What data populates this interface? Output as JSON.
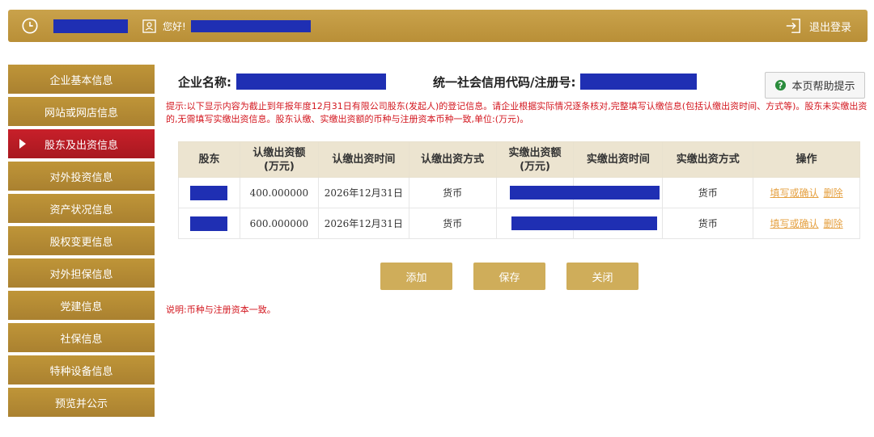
{
  "header": {
    "greeting": "您好!",
    "logout_label": "退出登录"
  },
  "sidebar": {
    "items": [
      {
        "label": "企业基本信息"
      },
      {
        "label": "网站或网店信息"
      },
      {
        "label": "股东及出资信息"
      },
      {
        "label": "对外投资信息"
      },
      {
        "label": "资产状况信息"
      },
      {
        "label": "股权变更信息"
      },
      {
        "label": "对外担保信息"
      },
      {
        "label": "党建信息"
      },
      {
        "label": "社保信息"
      },
      {
        "label": "特种设备信息"
      },
      {
        "label": "预览并公示"
      }
    ],
    "active_index": 2
  },
  "main": {
    "company_label": "企业名称:",
    "credit_label": "统一社会信用代码/注册号:",
    "help_label": "本页帮助提示",
    "tip": "提示:以下显示内容为截止到年报年度12月31日有限公司股东(发起人)的登记信息。请企业根据实际情况逐条核对,完整填写认缴信息(包括认缴出资时间、方式等)。股东未实缴出资的,无需填写实缴出资信息。股东认缴、实缴出资额的币种与注册资本币种一致,单位:(万元)。",
    "table": {
      "headers": [
        "股东",
        "认缴出资额\n(万元)",
        "认缴出资时间",
        "认缴出资方式",
        "实缴出资额\n(万元)",
        "实缴出资时间",
        "实缴出资方式",
        "操作"
      ],
      "rows": [
        {
          "subscribed_amount": "400.000000",
          "subscribed_date": "2026年12月31日",
          "subscribed_method": "货币",
          "paid_method": "货币",
          "action_edit": "填写或确认",
          "action_delete": "删除"
        },
        {
          "subscribed_amount": "600.000000",
          "subscribed_date": "2026年12月31日",
          "subscribed_method": "货币",
          "paid_method": "货币",
          "action_edit": "填写或确认",
          "action_delete": "删除"
        }
      ]
    },
    "buttons": {
      "add": "添加",
      "save": "保存",
      "close": "关闭"
    },
    "note": "说明:币种与注册资本一致。"
  },
  "colors": {
    "gold": "#c9a24b",
    "active_red": "#c8202a",
    "tip_red": "#d3161e",
    "link_orange": "#e5a040",
    "redaction": "#1f2fb3"
  }
}
